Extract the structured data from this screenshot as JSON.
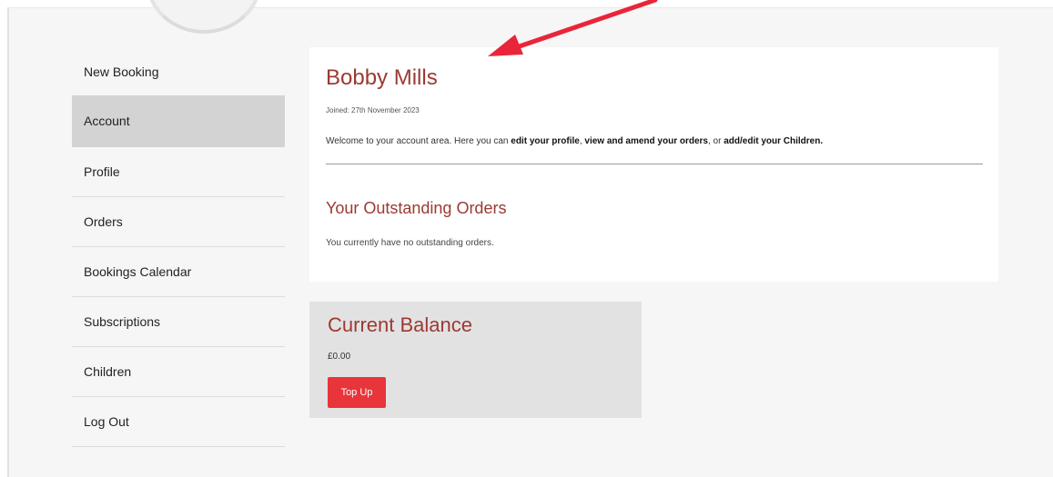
{
  "sidebar": {
    "items": [
      {
        "label": "New Booking"
      },
      {
        "label": "Account",
        "active": true
      },
      {
        "label": "Profile"
      },
      {
        "label": "Orders"
      },
      {
        "label": "Bookings Calendar"
      },
      {
        "label": "Subscriptions"
      },
      {
        "label": "Children"
      },
      {
        "label": "Log Out"
      }
    ]
  },
  "account": {
    "name": "Bobby Mills",
    "joined": "Joined: 27th November 2023",
    "welcome_prefix": "Welcome to your account area. Here you can ",
    "link_profile": "edit your profile",
    "sep1": ", ",
    "link_orders": "view and amend your orders",
    "sep2": ", or ",
    "link_children": "add/edit your Children.",
    "outstanding_heading": "Your Outstanding Orders",
    "outstanding_text": "You currently have no outstanding orders."
  },
  "balance": {
    "title": "Current Balance",
    "amount": "£0.00",
    "topup_label": "Top Up"
  },
  "colors": {
    "heading": "#9b3a32",
    "button": "#e8353a",
    "annotation_arrow": "#e8253a"
  }
}
